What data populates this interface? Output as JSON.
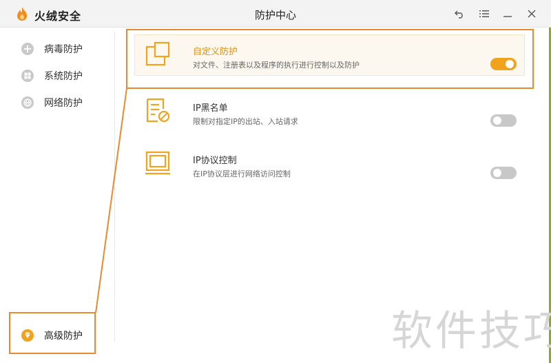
{
  "app": {
    "name": "火绒安全",
    "window_title": "防护中心"
  },
  "titlebar_icons": [
    "back-icon",
    "menu-icon",
    "minimize-icon",
    "close-icon"
  ],
  "sidebar": {
    "items": [
      {
        "label": "病毒防护",
        "icon": "virus-shield-icon"
      },
      {
        "label": "系统防护",
        "icon": "windows-icon"
      },
      {
        "label": "网络防护",
        "icon": "globe-icon"
      }
    ],
    "active": {
      "label": "高级防护",
      "icon": "diamond-icon"
    }
  },
  "rows": [
    {
      "title": "自定义防护",
      "desc": "对文件、注册表以及程序的执行进行控制以及防护",
      "enabled": true,
      "icon": "custom-protect-icon"
    },
    {
      "title": "IP黑名单",
      "desc": "限制对指定IP的出站、入站请求",
      "enabled": false,
      "icon": "ip-blacklist-icon"
    },
    {
      "title": "IP协议控制",
      "desc": "在IP协议层进行网络访问控制",
      "enabled": false,
      "icon": "ip-protocol-icon"
    }
  ],
  "colors": {
    "accent": "#f2a31d",
    "annotation": "#e8892e",
    "toggle_off": "#c8c8c8"
  },
  "watermark": "软件技巧"
}
